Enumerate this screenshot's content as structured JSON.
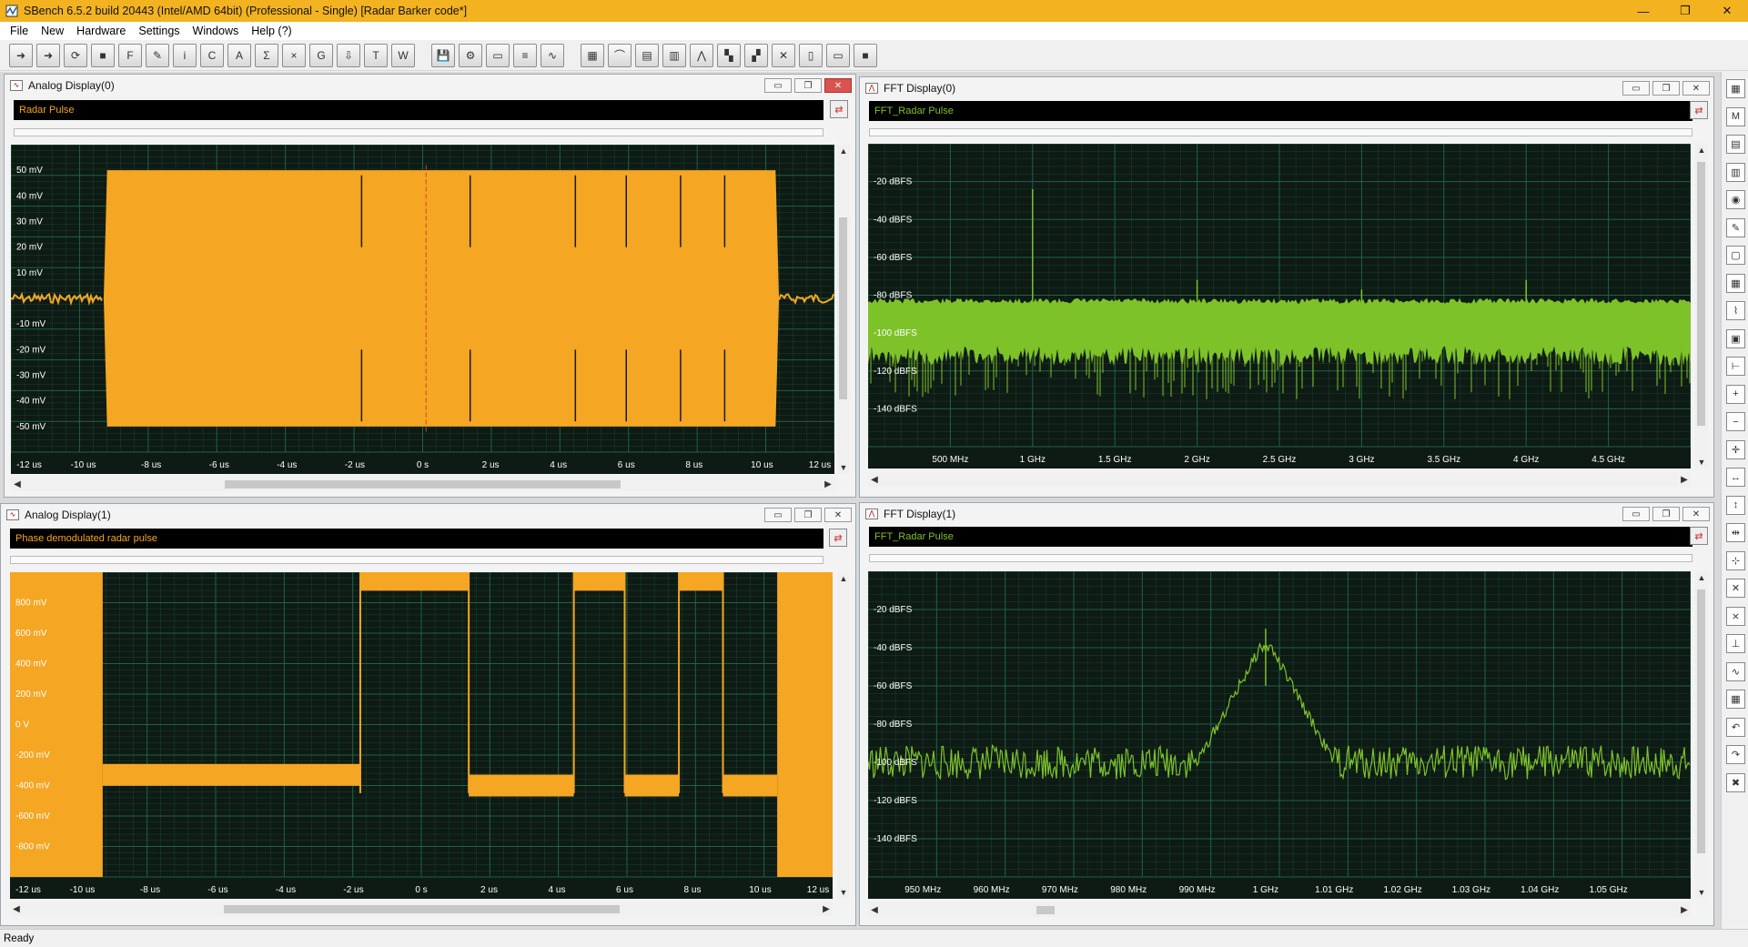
{
  "window": {
    "title": "SBench 6.5.2 build 20443 (Intel/AMD 64bit) (Professional - Single)    [Radar Barker code*]",
    "minimize": "—",
    "maximize": "❐",
    "close": "✕"
  },
  "menu": [
    "File",
    "New",
    "Hardware",
    "Settings",
    "Windows",
    "Help (?)"
  ],
  "toolbar": {
    "icons": [
      "import-arrow-icon",
      "export-arrow-icon",
      "loop-icon",
      "stop-icon",
      "force-trigger-icon",
      "calc-icon",
      "info-icon",
      "channel-icon",
      "analysis-icon",
      "statistics-icon",
      "mult-icon",
      "gain-icon",
      "export-data-icon",
      "text-export-icon",
      "wave-export-icon",
      "save-icon",
      "settings-gear-icon",
      "window-icon",
      "list-icon",
      "analog-display-icon",
      "grid-display-icon",
      "xy-display-icon",
      "waterfall-icon",
      "histogram-icon",
      "fft-icon",
      "tile-icon",
      "cascade-icon",
      "close-all-icon",
      "split-vertical-icon",
      "split-horizontal-icon",
      "full-icon"
    ],
    "glyphs": [
      "➜",
      "➜",
      "⟳",
      "■",
      "F",
      "✎",
      "i",
      "C",
      "A",
      "Σ",
      "×",
      "G",
      "⇩",
      "T",
      "W",
      "💾",
      "⚙",
      "▭",
      "≡",
      "∿",
      "▦",
      "⌒",
      "▤",
      "▥",
      "⋀",
      "▚",
      "▞",
      "✕",
      "▯",
      "▭",
      "■"
    ]
  },
  "panels": {
    "analog0": {
      "title": "Analog Display(0)",
      "name": "Radar Pulse",
      "y_ticks": [
        "50 mV",
        "40 mV",
        "30 mV",
        "20 mV",
        "10 mV",
        "-10 mV",
        "-20 mV",
        "-30 mV",
        "-40 mV",
        "-50 mV"
      ],
      "x_ticks": [
        "-12 us",
        "-10 us",
        "-8 us",
        "-6 us",
        "-4 us",
        "-2 us",
        "0 s",
        "2 us",
        "4 us",
        "6 us",
        "8 us",
        "10 us",
        "12 us"
      ]
    },
    "fft0": {
      "title": "FFT Display(0)",
      "name": "FFT_Radar Pulse",
      "y_ticks": [
        "-20 dBFS",
        "-40 dBFS",
        "-60 dBFS",
        "-80 dBFS",
        "-100 dBFS",
        "-120 dBFS",
        "-140 dBFS"
      ],
      "x_ticks": [
        "500 MHz",
        "1 GHz",
        "1.5 GHz",
        "2 GHz",
        "2.5 GHz",
        "3 GHz",
        "3.5 GHz",
        "4 GHz",
        "4.5 GHz"
      ]
    },
    "analog1": {
      "title": "Analog Display(1)",
      "name": "Phase demodulated radar pulse",
      "y_ticks": [
        "800 mV",
        "600 mV",
        "400 mV",
        "200 mV",
        "0 V",
        "-200 mV",
        "-400 mV",
        "-600 mV",
        "-800 mV"
      ],
      "x_ticks": [
        "-12 us",
        "-10 us",
        "-8 us",
        "-6 us",
        "-4 us",
        "-2 us",
        "0 s",
        "2 us",
        "4 us",
        "6 us",
        "8 us",
        "10 us",
        "12 us"
      ]
    },
    "fft1": {
      "title": "FFT Display(1)",
      "name": "FFT_Radar Pulse",
      "y_ticks": [
        "-20 dBFS",
        "-40 dBFS",
        "-60 dBFS",
        "-80 dBFS",
        "-100 dBFS",
        "-120 dBFS",
        "-140 dBFS"
      ],
      "x_ticks": [
        "950 MHz",
        "960 MHz",
        "970 MHz",
        "980 MHz",
        "990 MHz",
        "1 GHz",
        "1.01 GHz",
        "1.02 GHz",
        "1.03 GHz",
        "1.04 GHz",
        "1.05 GHz"
      ]
    }
  },
  "colors": {
    "analog_trace": "#f5a623",
    "analog_label": "#f5a623",
    "fft_trace": "#7ec22a",
    "fft_label": "#7ec22a",
    "grid": "#1f6b4a",
    "plot_bg": "#0e1a14",
    "tick_text": "#ffffff",
    "cursor": "#d9432a"
  },
  "right_toolbar": {
    "icons": [
      "grid-icon",
      "mode-icon",
      "table-icon",
      "book-icon",
      "camera-icon",
      "pen-icon",
      "doc-icon",
      "spreadsheet-icon",
      "scale-icon",
      "frame-icon",
      "measure-icon",
      "zoom-in-icon",
      "zoom-out-icon",
      "zoom-fit-icon",
      "zoom-x-icon",
      "zoom-y-icon",
      "align-icon",
      "cursor-icon",
      "cursor-x-icon",
      "cursor-xx-icon",
      "cursor-y-icon",
      "wave-icon",
      "grid2-icon",
      "undo-icon",
      "redo-icon",
      "delete-icon"
    ],
    "glyphs": [
      "▦",
      "M",
      "▤",
      "▥",
      "◉",
      "✎",
      "▢",
      "▦",
      "⌇",
      "▣",
      "⊢",
      "+",
      "−",
      "✛",
      "↔",
      "↕",
      "⇹",
      "⊹",
      "✕",
      "⨯",
      "⊥",
      "∿",
      "▦",
      "↶",
      "↷",
      "✖"
    ]
  },
  "status": "Ready"
}
